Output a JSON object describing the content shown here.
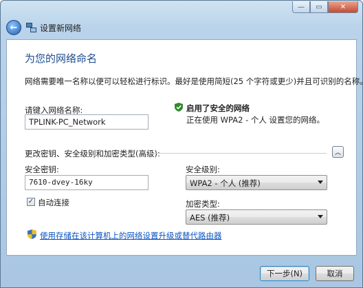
{
  "window": {
    "caption_min": "—",
    "caption_max": "▭",
    "caption_close": "✕"
  },
  "header": {
    "title": "设置新网络",
    "back_glyph": "←"
  },
  "page": {
    "title": "为您的网络命名",
    "description": "网络需要唯一名称以便可以轻松进行标识。最好是使用简短(25 个字符或更少)并且可识别的名称。"
  },
  "network_name": {
    "label": "请键入网络名称:",
    "value": "TPLINK-PC_Network"
  },
  "security_info": {
    "title": "启用了安全的网络",
    "detail": "正在使用 WPA2 - 个人 设置您的网络。"
  },
  "advanced": {
    "label": "更改密钥、安全级别和加密类型(高级):",
    "expander_glyph": "︿"
  },
  "security_key": {
    "label": "安全密钥:",
    "value": "7610-dvey-16ky"
  },
  "security_level": {
    "label": "安全级别:",
    "selected": "WPA2 - 个人 (推荐)"
  },
  "auto_connect": {
    "label": "自动连接",
    "checked": true,
    "check_glyph": "✓"
  },
  "encryption_type": {
    "label": "加密类型:",
    "selected": "AES (推荐)"
  },
  "upgrade_link": {
    "text": "使用存储在该计算机上的网络设置升级或替代路由器"
  },
  "buttons": {
    "next": "下一步(N)",
    "cancel": "取消"
  },
  "colors": {
    "title_blue": "#1f4d8e",
    "link_blue": "#0b53c0",
    "shield_green": "#2f8a2b"
  }
}
